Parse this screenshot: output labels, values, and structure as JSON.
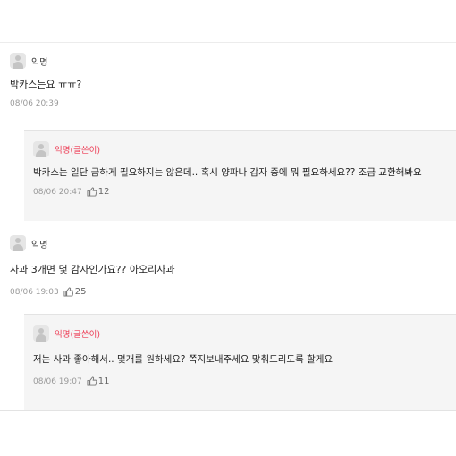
{
  "comments": [
    {
      "author": "익명",
      "text": "박카스는요 ㅠㅠ?",
      "date": "08/06 20:39",
      "reply": {
        "author": "익명(글쓴이)",
        "text": "박카스는 일단 급하게 필요하지는 않은데.. 혹시 양파나 감자 중에 뭐 필요하세요?? 조금 교환해봐요",
        "date": "08/06 20:47",
        "likes": "12"
      }
    },
    {
      "author": "익명",
      "text": "사과 3개면 몇 감자인가요?? 아오리사과",
      "date": "08/06 19:03",
      "likes": "25",
      "reply": {
        "author": "익명(글쓴이)",
        "text": "저는 사과 좋아해서.. 몇개를 원하세요? 쪽지보내주세요 맞춰드리도록 할게요",
        "date": "08/06 19:07",
        "likes": "11"
      }
    }
  ],
  "icons": {
    "avatar": "default-avatar-icon",
    "like": "thumbs-up-icon"
  },
  "colors": {
    "author_highlight": "#ed3b54",
    "reply_bg": "#f5f5f5"
  }
}
